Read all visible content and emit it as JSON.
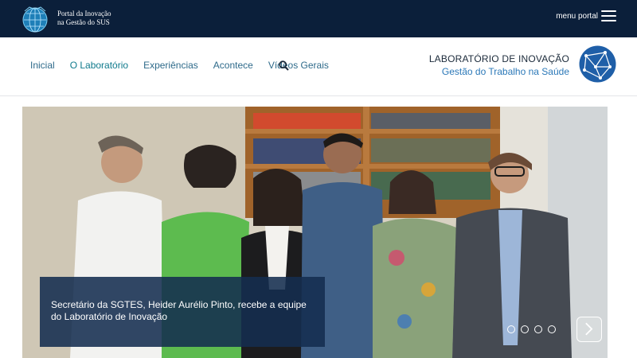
{
  "topbar": {
    "portal_name_line1": "Portal da Inovação",
    "portal_name_line2": "na Gestão do SUS",
    "menu_label": "menu portal",
    "bg_color": "#0b1f3a"
  },
  "nav": {
    "items": [
      {
        "label": "Inicial"
      },
      {
        "label": "O Laboratório"
      },
      {
        "label": "Experiências"
      },
      {
        "label": "Acontece"
      },
      {
        "label": "Vídeos Gerais"
      }
    ],
    "search_icon": "search-icon",
    "text_color": "#2e6a8a"
  },
  "lab": {
    "title": "LABORATÓRIO DE INOVAÇÃO",
    "subtitle": "Gestão do Trabalho na Saúde",
    "logo_icon": "network-globe-icon",
    "accent_color": "#1f5fa8"
  },
  "slider": {
    "caption": "Secretário da SGTES, Heider Aurélio Pinto, recebe a equipe do Laboratório de Inovação",
    "dots_count": 4,
    "next_icon": "chevron-right-icon",
    "caption_bg": "#142d50"
  }
}
